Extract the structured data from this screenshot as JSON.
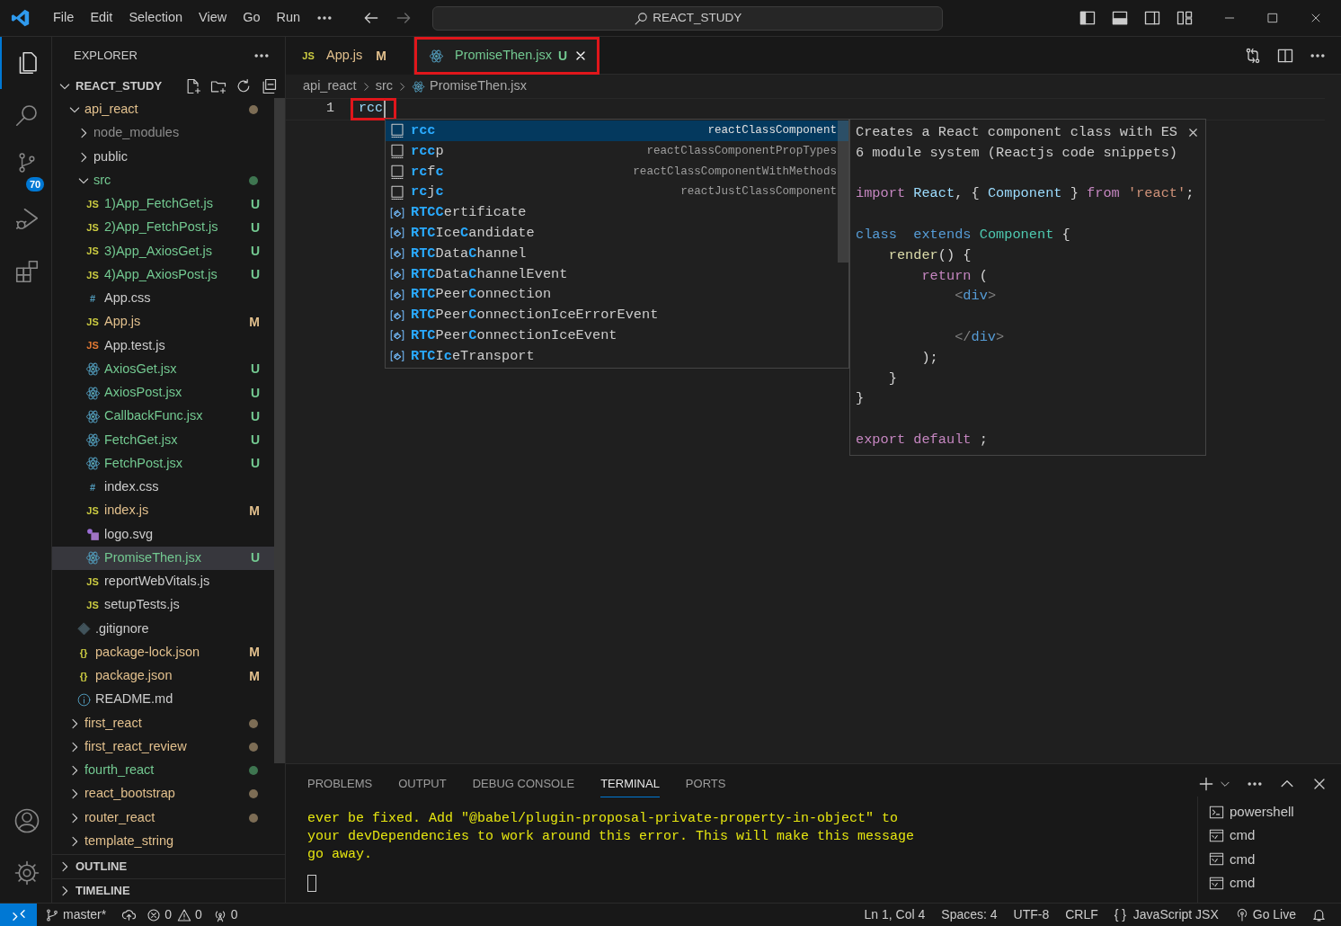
{
  "title_bar": {
    "menu": [
      "File",
      "Edit",
      "Selection",
      "View",
      "Go",
      "Run"
    ],
    "search": "REACT_STUDY"
  },
  "activity_bar": {
    "items": [
      {
        "kind": "explorer",
        "selected": true
      },
      {
        "kind": "search",
        "selected": false
      },
      {
        "kind": "scm",
        "selected": false,
        "badge": "70"
      },
      {
        "kind": "debug",
        "selected": false
      },
      {
        "kind": "extensions",
        "selected": false
      }
    ],
    "bottom": [
      {
        "kind": "account"
      },
      {
        "kind": "settings"
      }
    ]
  },
  "explorer": {
    "title": "EXPLORER",
    "root": {
      "label": "REACT_STUDY",
      "expanded": true
    },
    "tree": [
      {
        "label": "api_react",
        "kind": "folder",
        "color": "#e2c08d",
        "dot": {
          "color": "#7d6d55"
        },
        "expanded": true,
        "selected": false,
        "children": [
          {
            "label": "node_modules",
            "kind": "folder",
            "color": "#8c8c8c",
            "expanded": false,
            "selected": false
          },
          {
            "label": "public",
            "kind": "folder",
            "color": "#cccccc",
            "expanded": false,
            "selected": false
          },
          {
            "label": "src",
            "kind": "folder",
            "color": "#73c991",
            "dot": {
              "color": "#3e7550"
            },
            "expanded": true,
            "selected": false,
            "children": [
              {
                "label": "1)App_FetchGet.js",
                "kind": "js",
                "glyph": "JS",
                "color": "#73c991",
                "badge": "U",
                "selected": false
              },
              {
                "label": "2)App_FetchPost.js",
                "kind": "js",
                "glyph": "JS",
                "color": "#73c991",
                "badge": "U",
                "selected": false
              },
              {
                "label": "3)App_AxiosGet.js",
                "kind": "js",
                "glyph": "JS",
                "color": "#73c991",
                "badge": "U",
                "selected": false
              },
              {
                "label": "4)App_AxiosPost.js",
                "kind": "js",
                "glyph": "JS",
                "color": "#73c991",
                "badge": "U",
                "selected": false
              },
              {
                "label": "App.css",
                "kind": "css",
                "glyph": "#",
                "color": "#cccccc",
                "selected": false
              },
              {
                "label": "App.js",
                "kind": "js",
                "glyph": "JS",
                "color": "#e2c08d",
                "badge": "M",
                "selected": false
              },
              {
                "label": "App.test.js",
                "kind": "test",
                "glyph": "JS",
                "color": "#cccccc",
                "selected": false
              },
              {
                "label": "AxiosGet.jsx",
                "kind": "react",
                "color": "#73c991",
                "badge": "U",
                "selected": false
              },
              {
                "label": "AxiosPost.jsx",
                "kind": "react",
                "color": "#73c991",
                "badge": "U",
                "selected": false
              },
              {
                "label": "CallbackFunc.jsx",
                "kind": "react",
                "color": "#73c991",
                "badge": "U",
                "selected": false
              },
              {
                "label": "FetchGet.jsx",
                "kind": "react",
                "color": "#73c991",
                "badge": "U",
                "selected": false
              },
              {
                "label": "FetchPost.jsx",
                "kind": "react",
                "color": "#73c991",
                "badge": "U",
                "selected": false
              },
              {
                "label": "index.css",
                "kind": "css",
                "glyph": "#",
                "color": "#cccccc",
                "selected": false
              },
              {
                "label": "index.js",
                "kind": "js",
                "glyph": "JS",
                "color": "#e2c08d",
                "badge": "M",
                "selected": false
              },
              {
                "label": "logo.svg",
                "kind": "image",
                "color": "#cccccc",
                "selected": false
              },
              {
                "label": "PromiseThen.jsx",
                "kind": "react",
                "color": "#73c991",
                "badge": "U",
                "selected": true
              },
              {
                "label": "reportWebVitals.js",
                "kind": "js",
                "glyph": "JS",
                "color": "#cccccc",
                "selected": false
              },
              {
                "label": "setupTests.js",
                "kind": "js",
                "glyph": "JS",
                "color": "#cccccc",
                "selected": false
              }
            ]
          },
          {
            "label": ".gitignore",
            "kind": "git",
            "color": "#cccccc",
            "selected": false
          },
          {
            "label": "package-lock.json",
            "kind": "json",
            "glyph": "{}",
            "color": "#e2c08d",
            "badge": "M",
            "selected": false
          },
          {
            "label": "package.json",
            "kind": "json",
            "glyph": "{}",
            "color": "#e2c08d",
            "badge": "M",
            "selected": false
          },
          {
            "label": "README.md",
            "kind": "info",
            "color": "#cccccc",
            "selected": false
          }
        ]
      },
      {
        "label": "first_react",
        "kind": "folder",
        "color": "#e2c08d",
        "dot": {
          "color": "#7d6d55"
        },
        "expanded": false,
        "selected": false
      },
      {
        "label": "first_react_review",
        "kind": "folder",
        "color": "#e2c08d",
        "dot": {
          "color": "#7d6d55"
        },
        "expanded": false,
        "selected": false
      },
      {
        "label": "fourth_react",
        "kind": "folder",
        "color": "#73c991",
        "dot": {
          "color": "#3e7550"
        },
        "expanded": false,
        "selected": false
      },
      {
        "label": "react_bootstrap",
        "kind": "folder",
        "color": "#e2c08d",
        "dot": {
          "color": "#7d6d55"
        },
        "expanded": false,
        "selected": false
      },
      {
        "label": "router_react",
        "kind": "folder",
        "color": "#e2c08d",
        "dot": {
          "color": "#7d6d55"
        },
        "expanded": false,
        "selected": false
      },
      {
        "label": "template_string",
        "kind": "folder",
        "color": "#e2c08d",
        "expanded": false,
        "selected": false
      }
    ],
    "sections": [
      {
        "label": "OUTLINE",
        "expanded": false
      },
      {
        "label": "TIMELINE",
        "expanded": false
      }
    ]
  },
  "tabs": [
    {
      "label": "App.js",
      "kind": "js",
      "glyph": "JS",
      "color": "#e2c08d",
      "badge": "M",
      "selected": false,
      "annotated": false
    },
    {
      "label": "PromiseThen.jsx",
      "kind": "react",
      "color": "#73c991",
      "badge": "U",
      "selected": true,
      "annotated": true
    }
  ],
  "breadcrumb": [
    {
      "label": "api_react"
    },
    {
      "label": "src"
    },
    {
      "label": "PromiseThen.jsx",
      "kind": "react"
    }
  ],
  "editor": {
    "lines": [
      {
        "number": "1",
        "text": "rcc",
        "annotated": true
      }
    ]
  },
  "suggestions": [
    {
      "kind": "snippet",
      "selected": true,
      "segments": [
        {
          "text": "rcc",
          "match": true
        }
      ],
      "detail": "reactClassComponent"
    },
    {
      "kind": "snippet",
      "selected": false,
      "segments": [
        {
          "text": "rcc",
          "match": true
        },
        {
          "text": "p",
          "match": false
        }
      ],
      "detail": "reactClassComponentPropTypes"
    },
    {
      "kind": "snippet",
      "selected": false,
      "segments": [
        {
          "text": "rc",
          "match": true
        },
        {
          "text": "f",
          "match": false
        },
        {
          "text": "c",
          "match": true
        }
      ],
      "detail": "reactClassComponentWithMethods"
    },
    {
      "kind": "snippet",
      "selected": false,
      "segments": [
        {
          "text": "rc",
          "match": true
        },
        {
          "text": "j",
          "match": false
        },
        {
          "text": "c",
          "match": true
        }
      ],
      "detail": "reactJustClassComponent"
    },
    {
      "kind": "variable",
      "selected": false,
      "segments": [
        {
          "text": "RTCC",
          "match": true
        },
        {
          "text": "ertificate",
          "match": false
        }
      ]
    },
    {
      "kind": "variable",
      "selected": false,
      "segments": [
        {
          "text": "RTC",
          "match": true
        },
        {
          "text": "Ice",
          "match": false
        },
        {
          "text": "C",
          "match": true
        },
        {
          "text": "andidate",
          "match": false
        }
      ]
    },
    {
      "kind": "variable",
      "selected": false,
      "segments": [
        {
          "text": "RTC",
          "match": true
        },
        {
          "text": "Data",
          "match": false
        },
        {
          "text": "C",
          "match": true
        },
        {
          "text": "hannel",
          "match": false
        }
      ]
    },
    {
      "kind": "variable",
      "selected": false,
      "segments": [
        {
          "text": "RTC",
          "match": true
        },
        {
          "text": "Data",
          "match": false
        },
        {
          "text": "C",
          "match": true
        },
        {
          "text": "hannelEvent",
          "match": false
        }
      ]
    },
    {
      "kind": "variable",
      "selected": false,
      "segments": [
        {
          "text": "RTC",
          "match": true
        },
        {
          "text": "Peer",
          "match": false
        },
        {
          "text": "C",
          "match": true
        },
        {
          "text": "onnection",
          "match": false
        }
      ]
    },
    {
      "kind": "variable",
      "selected": false,
      "segments": [
        {
          "text": "RTC",
          "match": true
        },
        {
          "text": "Peer",
          "match": false
        },
        {
          "text": "C",
          "match": true
        },
        {
          "text": "onnectionIceErrorEvent",
          "match": false
        }
      ]
    },
    {
      "kind": "variable",
      "selected": false,
      "segments": [
        {
          "text": "RTC",
          "match": true
        },
        {
          "text": "Peer",
          "match": false
        },
        {
          "text": "C",
          "match": true
        },
        {
          "text": "onnectionIceEvent",
          "match": false
        }
      ]
    },
    {
      "kind": "variable",
      "selected": false,
      "segments": [
        {
          "text": "RTC",
          "match": true
        },
        {
          "text": "I",
          "match": false
        },
        {
          "text": "c",
          "match": true
        },
        {
          "text": "eTransport",
          "match": false
        }
      ]
    }
  ],
  "doc": {
    "description": "Creates a React component class with ES 6 module system (Reactjs code snippets)",
    "code_blocks": [
      {
        "lines": [
          {
            "tokens": [
              {
                "text": "import",
                "kind": "keyword"
              },
              {
                "text": " React",
                "kind": "variable"
              },
              {
                "text": ", { ",
                "kind": "punct"
              },
              {
                "text": "Component",
                "kind": "variable"
              },
              {
                "text": " } ",
                "kind": "punct"
              },
              {
                "text": "from",
                "kind": "keyword"
              },
              {
                "text": " 'react'",
                "kind": "string"
              },
              {
                "text": ";",
                "kind": "punct"
              }
            ]
          }
        ]
      },
      {
        "lines": [
          {
            "tokens": [
              {
                "text": "class",
                "kind": "storage"
              },
              {
                "text": "  extends",
                "kind": "storage"
              },
              {
                "text": " Component",
                "kind": "type"
              },
              {
                "text": " {",
                "kind": "punct"
              }
            ]
          },
          {
            "tokens": [
              {
                "text": "    render",
                "kind": "function"
              },
              {
                "text": "() {",
                "kind": "punct"
              }
            ]
          },
          {
            "tokens": [
              {
                "text": "        return",
                "kind": "keyword"
              },
              {
                "text": " (",
                "kind": "punct"
              }
            ]
          },
          {
            "tokens": [
              {
                "text": "            <",
                "kind": "bracket"
              },
              {
                "text": "div",
                "kind": "tag"
              },
              {
                "text": ">",
                "kind": "bracket"
              }
            ]
          }
        ]
      },
      {
        "lines": [
          {
            "tokens": [
              {
                "text": "            </",
                "kind": "bracket"
              },
              {
                "text": "div",
                "kind": "tag"
              },
              {
                "text": ">",
                "kind": "bracket"
              }
            ]
          },
          {
            "tokens": [
              {
                "text": "        );",
                "kind": "punct"
              }
            ]
          },
          {
            "tokens": [
              {
                "text": "    }",
                "kind": "punct"
              }
            ]
          },
          {
            "tokens": [
              {
                "text": "}",
                "kind": "punct"
              }
            ]
          }
        ]
      },
      {
        "lines": [
          {
            "tokens": [
              {
                "text": "export",
                "kind": "keyword"
              },
              {
                "text": " default",
                "kind": "keyword"
              },
              {
                "text": " ;",
                "kind": "punct"
              }
            ]
          }
        ]
      }
    ]
  },
  "panel": {
    "tabs": [
      {
        "label": "PROBLEMS",
        "selected": false
      },
      {
        "label": "OUTPUT",
        "selected": false
      },
      {
        "label": "DEBUG CONSOLE",
        "selected": false
      },
      {
        "label": "TERMINAL",
        "selected": true
      },
      {
        "label": "PORTS",
        "selected": false
      }
    ],
    "terminal_lines": [
      "ever be fixed. Add \"@babel/plugin-proposal-private-property-in-object\" to",
      "your devDependencies to work around this error. This will make this message",
      "go away."
    ],
    "terminals": [
      {
        "label": "powershell",
        "kind": "powershell"
      },
      {
        "label": "cmd",
        "kind": "cmd"
      },
      {
        "label": "cmd",
        "kind": "cmd"
      },
      {
        "label": "cmd",
        "kind": "cmd"
      }
    ]
  },
  "status_bar": {
    "left": [
      {
        "kind": "remote"
      },
      {
        "kind": "branch",
        "text": "master*"
      },
      {
        "kind": "sync"
      },
      {
        "kind": "errors",
        "text": "0"
      },
      {
        "kind": "warnings",
        "text": "0"
      },
      {
        "kind": "ports",
        "text": "0"
      }
    ],
    "right": [
      {
        "kind": "text",
        "text": "Ln 1, Col 4"
      },
      {
        "kind": "text",
        "text": "Spaces: 4"
      },
      {
        "kind": "text",
        "text": "UTF-8"
      },
      {
        "kind": "text",
        "text": "CRLF"
      },
      {
        "kind": "language",
        "text": "{ }  JavaScript JSX"
      },
      {
        "kind": "live",
        "text": "Go Live"
      },
      {
        "kind": "bell"
      }
    ]
  }
}
